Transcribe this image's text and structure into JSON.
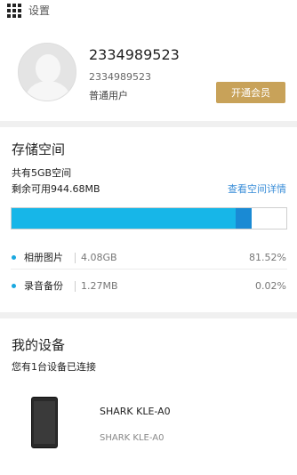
{
  "header": {
    "title": "设置",
    "menu_icon": "grid-menu-icon"
  },
  "profile": {
    "name": "2334989523",
    "account_id": "2334989523",
    "role": "普通用户",
    "vip_button_label": "开通会员",
    "avatar_icon": "default-avatar-icon",
    "colors": {
      "vip_button": "#c8a259"
    }
  },
  "storage": {
    "title": "存储空间",
    "total_text": "共有5GB空间",
    "remaining_text": "剩余可用944.68MB",
    "detail_link": "查看空间详情",
    "usage_bar": {
      "photos_fraction": 0.8152,
      "audio_fraction": 0.0002
    },
    "categories": [
      {
        "name": "相册图片",
        "size": "4.08GB",
        "percent": "81.52%"
      },
      {
        "name": "录音备份",
        "size": "1.27MB",
        "percent": "0.02%"
      }
    ],
    "colors": {
      "photos": "#17b6e8",
      "audio": "#1a8ad4",
      "link": "#3a8ed8"
    }
  },
  "devices": {
    "title": "我的设备",
    "subtitle": "您有1台设备已连接",
    "items": [
      {
        "name": "SHARK KLE-A0",
        "model": "SHARK KLE-A0",
        "icon": "phone-icon"
      }
    ]
  }
}
